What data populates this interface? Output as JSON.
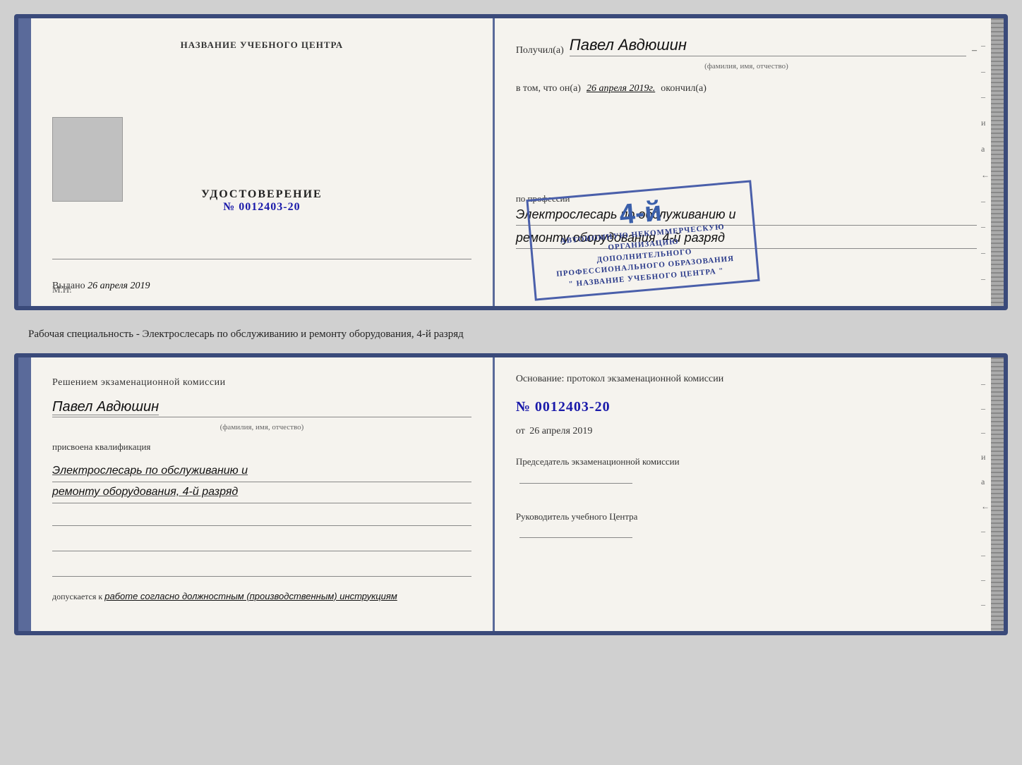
{
  "top_doc": {
    "left": {
      "header": "НАЗВАНИЕ УЧЕБНОГО ЦЕНТРА",
      "cert_title": "УДОСТОВЕРЕНИЕ",
      "cert_number": "№ 0012403-20",
      "issued_label": "Выдано",
      "issued_date": "26 апреля 2019",
      "mp_label": "М.П."
    },
    "right": {
      "received_label": "Получил(а)",
      "recipient_name": "Павел Авдюшин",
      "name_subtitle": "(фамилия, имя, отчество)",
      "in_that_label": "в том, что он(а)",
      "date_label": "26 апреля 2019г.",
      "finished_label": "окончил(а)",
      "stamp_grade": "4-й",
      "stamp_line1": "АВТОНОМНУЮ НЕКОММЕРЧЕСКУЮ ОРГАНИЗАЦИЮ",
      "stamp_line2": "ДОПОЛНИТЕЛЬНОГО ПРОФЕССИОНАЛЬНОГО ОБРАЗОВАНИЯ",
      "stamp_line3": "\" НАЗВАНИЕ УЧЕБНОГО ЦЕНТРА \"",
      "profession_label": "по профессии",
      "profession_text_line1": "Электрослесарь по обслуживанию и",
      "profession_text_line2": "ремонту оборудования, 4-й разряд"
    }
  },
  "middle_label": {
    "text": "Рабочая специальность - Электрослесарь по обслуживанию и ремонту оборудования, 4-й разряд"
  },
  "bottom_doc": {
    "left": {
      "commission_text": "Решением экзаменационной комиссии",
      "person_name": "Павел Авдюшин",
      "name_subtitle": "(фамилия, имя, отчество)",
      "assigned_label": "присвоена квалификация",
      "qualification_line1": "Электрослесарь по обслуживанию и",
      "qualification_line2": "ремонту оборудования, 4-й разряд",
      "allowed_label": "допускается к",
      "allowed_text": "работе согласно должностным (производственным) инструкциям"
    },
    "right": {
      "basis_label": "Основание: протокол экзаменационной комиссии",
      "protocol_number": "№ 0012403-20",
      "date_prefix": "от",
      "date_value": "26 апреля 2019",
      "chairman_label": "Председатель экзаменационной комиссии",
      "director_label": "Руководитель учебного Центра"
    }
  },
  "right_marks": [
    "–",
    "–",
    "–",
    "и",
    "а",
    "←",
    "–",
    "–",
    "–",
    "–"
  ]
}
